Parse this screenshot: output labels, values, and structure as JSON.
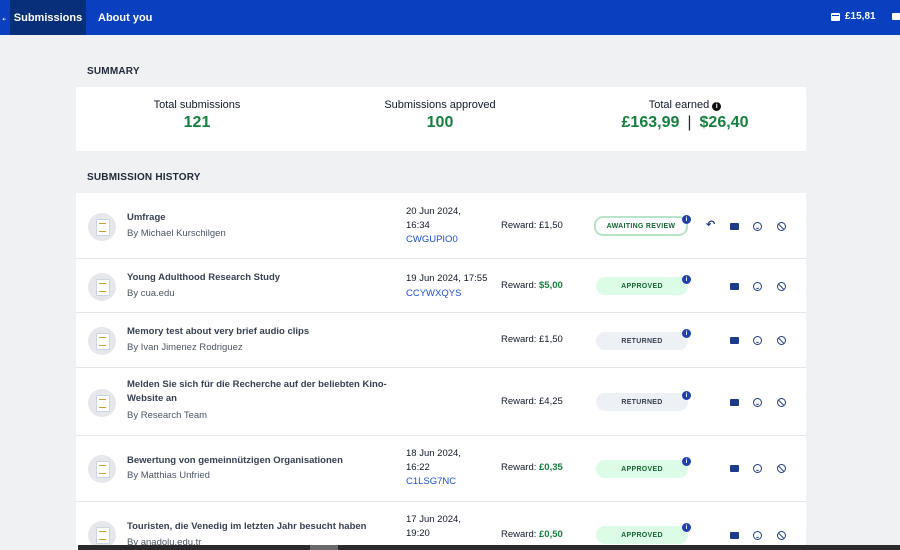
{
  "topbar": {
    "edge_glyph": "←",
    "tabs": [
      {
        "label": "Submissions",
        "active": true
      },
      {
        "label": "About you",
        "active": false
      }
    ],
    "balance": "£15,81"
  },
  "summary": {
    "heading": "SUMMARY",
    "total_submissions_label": "Total submissions",
    "total_submissions": "121",
    "approved_label": "Submissions approved",
    "approved": "100",
    "earned_label": "Total earned",
    "earned_gbp": "£163,99",
    "earned_separator": "|",
    "earned_usd": "$26,40",
    "info_glyph": "i"
  },
  "history": {
    "heading": "SUBMISSION HISTORY",
    "reward_label": "Reward:",
    "rows": [
      {
        "title": "Umfrage",
        "by": "By Michael Kurschilgen",
        "date": "20 Jun 2024,\n16:34",
        "code": "CWGUPIO0",
        "reward": "£1,50",
        "reward_green": false,
        "status": "AWAITING REVIEW",
        "status_kind": "awaiting",
        "has_undo": true
      },
      {
        "title": "Young Adulthood Research Study",
        "by": "By cua.edu",
        "date": "19 Jun 2024, 17:55",
        "code": "CCYWXQYS",
        "reward": "$5,00",
        "reward_green": true,
        "status": "APPROVED",
        "status_kind": "approved",
        "has_undo": false
      },
      {
        "title": "Memory test about very brief audio clips",
        "by": "By Ivan Jimenez Rodriguez",
        "date": "",
        "code": "",
        "reward": "£1,50",
        "reward_green": false,
        "status": "RETURNED",
        "status_kind": "returned",
        "has_undo": false
      },
      {
        "title": "Melden Sie sich für die Recherche auf der beliebten Kino-\nWebsite an",
        "by": "By Research Team",
        "date": "",
        "code": "",
        "reward": "£4,25",
        "reward_green": false,
        "status": "RETURNED",
        "status_kind": "returned",
        "has_undo": false
      },
      {
        "title": "Bewertung von gemeinnützigen Organisationen",
        "by": "By Matthias Unfried",
        "date": "18 Jun 2024,\n16:22",
        "code": "C1LSG7NC",
        "reward": "£0,35",
        "reward_green": true,
        "status": "APPROVED",
        "status_kind": "approved",
        "has_undo": false
      },
      {
        "title": "Touristen, die Venedig im letzten Jahr besucht haben",
        "by": "By anadolu.edu.tr",
        "date": "17 Jun 2024,\n19:20",
        "code": "",
        "reward": "£0,50",
        "reward_green": true,
        "status": "APPROVED",
        "status_kind": "approved",
        "has_undo": false
      }
    ]
  },
  "icons": {
    "undo": "undo-icon",
    "mail": "mail-icon",
    "smile": "smile-icon",
    "ban": "ban-icon",
    "wallet": "wallet-icon",
    "doc": "document-icon"
  },
  "colors": {
    "topbar": "#0a3fbf",
    "active_tab": "#082f7a",
    "green": "#15803d",
    "link_blue": "#1d4ed8"
  }
}
